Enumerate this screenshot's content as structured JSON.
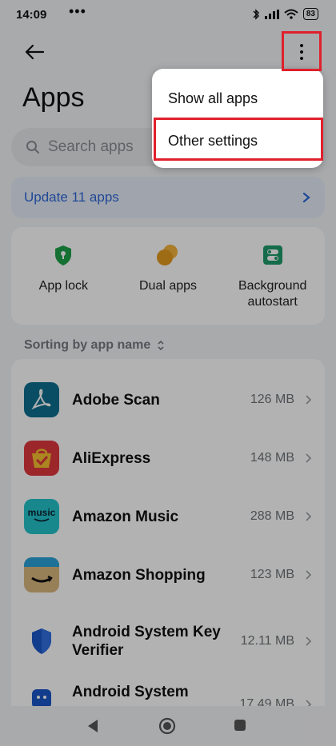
{
  "status_bar": {
    "time": "14:09",
    "notif_dots": "•••",
    "battery": "83"
  },
  "header": {
    "title": "Apps"
  },
  "search": {
    "placeholder": "Search apps"
  },
  "update_banner": {
    "label": "Update 11 apps"
  },
  "quick_actions": [
    {
      "label": "App lock",
      "icon": "shield-lock-icon"
    },
    {
      "label": "Dual apps",
      "icon": "dual-circles-icon"
    },
    {
      "label": "Background autostart",
      "icon": "toggle-icon"
    }
  ],
  "sorting": {
    "label": "Sorting by app name"
  },
  "apps": [
    {
      "name": "Adobe Scan",
      "size": "126 MB",
      "icon": "adobe-scan-icon"
    },
    {
      "name": "AliExpress",
      "size": "148 MB",
      "icon": "aliexpress-icon"
    },
    {
      "name": "Amazon Music",
      "size": "288 MB",
      "icon": "amazon-music-icon",
      "icon_text": "music"
    },
    {
      "name": "Amazon Shopping",
      "size": "123 MB",
      "icon": "amazon-shopping-icon"
    },
    {
      "name": "Android System Key Verifier",
      "size": "12.11 MB",
      "icon": "key-verifier-icon"
    },
    {
      "name": "Android System",
      "size": "17.49 MB",
      "icon": "android-system-icon"
    }
  ],
  "menu": {
    "items": [
      "Show all apps",
      "Other settings"
    ]
  },
  "colors": {
    "accent_blue": "#2e67d8",
    "highlight_red": "#e0202c",
    "app_lock_green": "#1fa24a",
    "dual_apps_orange": "#e39b1f",
    "autostart_teal": "#1f9b6b"
  }
}
